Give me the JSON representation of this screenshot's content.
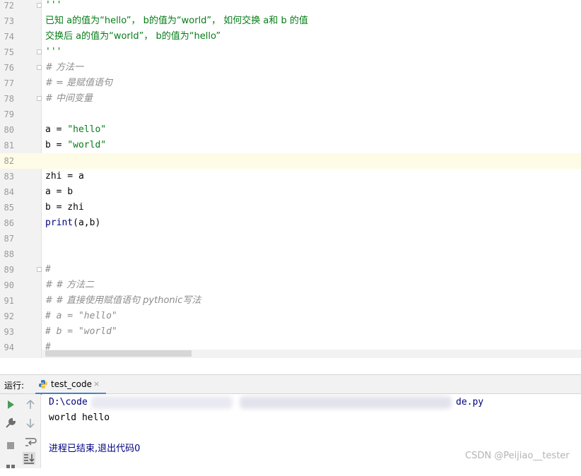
{
  "editor": {
    "lines": [
      {
        "number": "72",
        "text": "'''",
        "style": "doc",
        "fold": true
      },
      {
        "number": "73",
        "text": "已知 a的值为“hello”， b的值为“world”， 如何交换 a和 b 的值",
        "style": "doc",
        "fold": false
      },
      {
        "number": "74",
        "text": "交换后 a的值为“world”， b的值为“hello”",
        "style": "doc",
        "fold": false
      },
      {
        "number": "75",
        "text": "'''",
        "style": "doc",
        "fold": true
      },
      {
        "number": "76",
        "text": "# 方法一",
        "style": "comment",
        "fold": true
      },
      {
        "number": "77",
        "text": "# = 是赋值语句",
        "style": "comment",
        "fold": false
      },
      {
        "number": "78",
        "text": "# 中间变量",
        "style": "comment",
        "fold": true
      },
      {
        "number": "79",
        "text": "",
        "style": "plain",
        "fold": false
      },
      {
        "number": "80",
        "text": "a = \"hello\"",
        "style": "plain",
        "fold": false
      },
      {
        "number": "81",
        "text": "b = \"world\"",
        "style": "plain",
        "fold": false
      },
      {
        "number": "82",
        "text": "",
        "style": "plain",
        "fold": false,
        "current": true
      },
      {
        "number": "83",
        "text": "zhi = a",
        "style": "plain",
        "fold": false
      },
      {
        "number": "84",
        "text": "a = b",
        "style": "plain",
        "fold": false
      },
      {
        "number": "85",
        "text": "b = zhi",
        "style": "plain",
        "fold": false
      },
      {
        "number": "86",
        "text": "print(a,b)",
        "style": "plain",
        "fold": false
      },
      {
        "number": "87",
        "text": "",
        "style": "plain",
        "fold": false
      },
      {
        "number": "88",
        "text": "",
        "style": "plain",
        "fold": false
      },
      {
        "number": "89",
        "text": "#",
        "style": "comment",
        "fold": true
      },
      {
        "number": "90",
        "text": "# # 方法二",
        "style": "comment",
        "fold": false
      },
      {
        "number": "91",
        "text": "# # 直接使用赋值语句 pythonic写法",
        "style": "comment",
        "fold": false
      },
      {
        "number": "92",
        "text": "# a = \"hello\"",
        "style": "comment",
        "fold": false
      },
      {
        "number": "93",
        "text": "# b = \"world\"",
        "style": "comment",
        "fold": false
      },
      {
        "number": "94",
        "text": "#",
        "style": "comment",
        "fold": false
      }
    ]
  },
  "run_panel": {
    "label": "运行:",
    "tab_label": "test_code",
    "tab_close": "×",
    "console": {
      "path_start": "D:\\code",
      "path_end": "de.py",
      "output": "world hello",
      "exit_message": "进程已结束,退出代码0"
    }
  },
  "toolbar_icons": [
    "run-icon",
    "up-arrow-icon",
    "wrench-icon",
    "down-arrow-icon",
    "stop-icon",
    "soft-wrap-icon",
    "scroll-to-end-icon"
  ],
  "watermark": "CSDN @Peijiao__tester",
  "colors": {
    "docstring": "#067d17",
    "comment": "#8c8c8c",
    "current_line": "#fefbe6",
    "run_green": "#499c54",
    "tab_underline": "#4083c9"
  }
}
